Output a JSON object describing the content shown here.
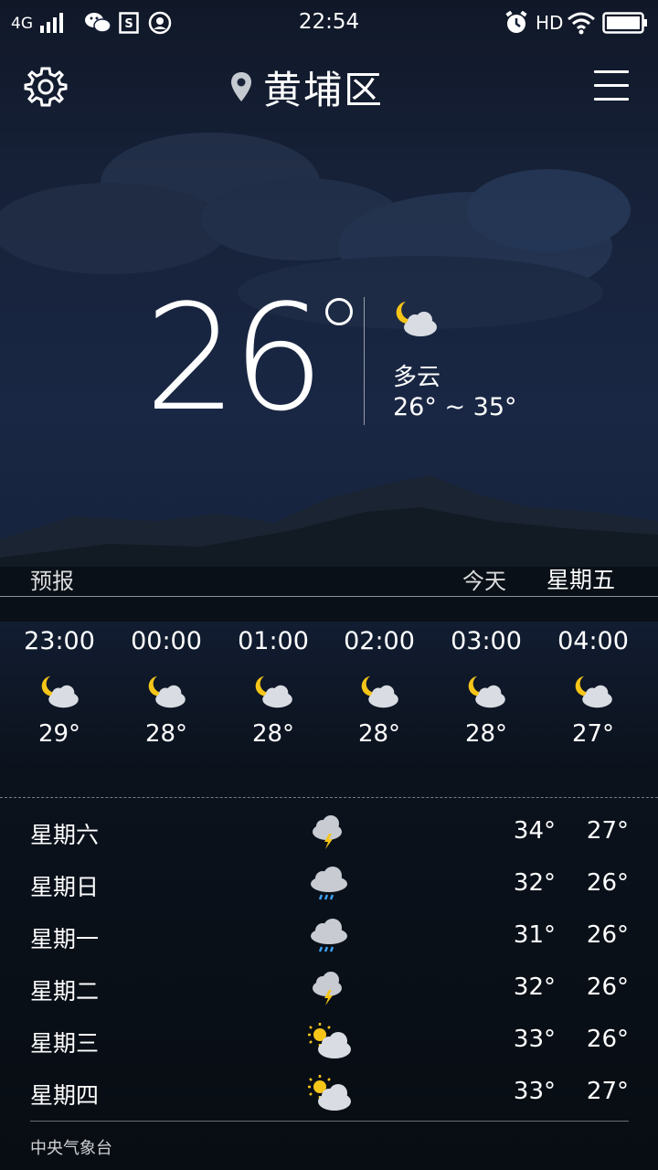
{
  "status_bar": {
    "network": "4G",
    "time": "22:54",
    "hd": "HD",
    "icons": [
      "signal-icon",
      "wechat-icon",
      "sim-icon",
      "notification-icon",
      "alarm-icon",
      "wifi-icon",
      "battery-icon"
    ]
  },
  "header": {
    "city": "黄埔区",
    "icons": [
      "settings-gear-icon",
      "location-pin-icon",
      "menu-hamburger-icon"
    ]
  },
  "current": {
    "temperature": "26",
    "condition": "多云",
    "range": "26° ~ 35°",
    "icon": "partly-cloudy-night-icon"
  },
  "forecast_header": {
    "label": "预报",
    "today": "今天",
    "weekday": "星期五"
  },
  "hourly": [
    {
      "time": "23:00",
      "temp": "29°",
      "icon": "partly-cloudy-night-icon"
    },
    {
      "time": "00:00",
      "temp": "28°",
      "icon": "partly-cloudy-night-icon"
    },
    {
      "time": "01:00",
      "temp": "28°",
      "icon": "partly-cloudy-night-icon"
    },
    {
      "time": "02:00",
      "temp": "28°",
      "icon": "partly-cloudy-night-icon"
    },
    {
      "time": "03:00",
      "temp": "28°",
      "icon": "partly-cloudy-night-icon"
    },
    {
      "time": "04:00",
      "temp": "27°",
      "icon": "partly-cloudy-night-icon"
    }
  ],
  "daily": [
    {
      "day": "星期六",
      "high": "34°",
      "low": "27°",
      "icon": "thunderstorm-icon"
    },
    {
      "day": "星期日",
      "high": "32°",
      "low": "26°",
      "icon": "rain-icon"
    },
    {
      "day": "星期一",
      "high": "31°",
      "low": "26°",
      "icon": "rain-icon"
    },
    {
      "day": "星期二",
      "high": "32°",
      "low": "26°",
      "icon": "thunderstorm-icon"
    },
    {
      "day": "星期三",
      "high": "33°",
      "low": "26°",
      "icon": "partly-sunny-icon"
    },
    {
      "day": "星期四",
      "high": "33°",
      "low": "27°",
      "icon": "partly-sunny-icon"
    }
  ],
  "footer": {
    "source": "中央气象台"
  },
  "colors": {
    "moon": "#f5c518",
    "sun": "#f5c518",
    "cloud": "#d9dde3",
    "rain_cloud": "#c8ccd2",
    "bolt": "#f5c518",
    "rain": "#3aa0f0"
  }
}
